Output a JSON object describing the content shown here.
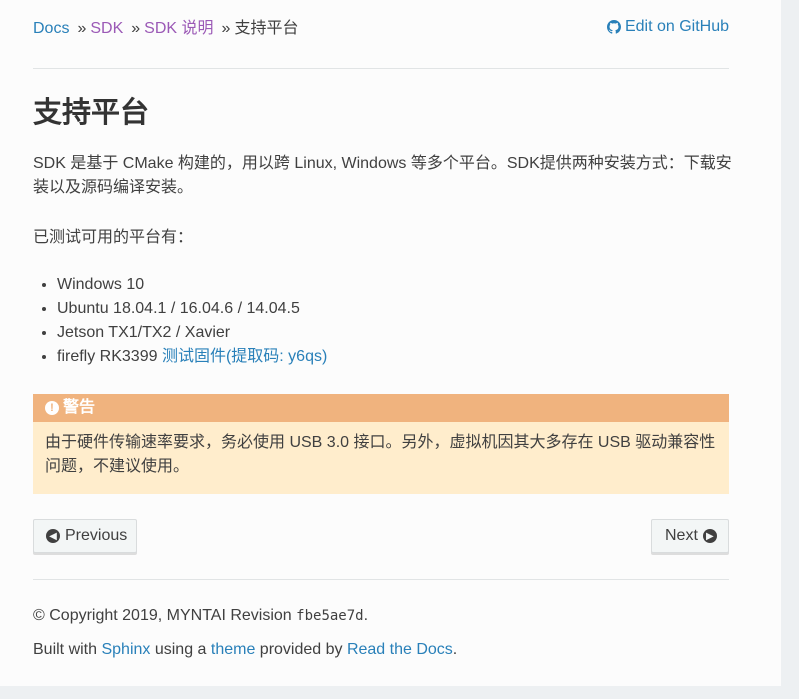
{
  "breadcrumbs": {
    "items": [
      {
        "label": "Docs"
      },
      {
        "label": "SDK"
      },
      {
        "label": "SDK 说明"
      }
    ],
    "separator": "»",
    "current": "支持平台",
    "edit_link": "Edit on GitHub"
  },
  "page": {
    "title": "支持平台",
    "intro": "SDK 是基于 CMake 构建的，用以跨 Linux, Windows 等多个平台。SDK提供两种安装方式：下载安装以及源码编译安装。",
    "tested_label": "已测试可用的平台有：",
    "platforms": [
      "Windows 10",
      "Ubuntu 18.04.1 / 16.04.6 / 14.04.5",
      "Jetson TX1/TX2 / Xavier",
      "firefly RK3399"
    ],
    "firmware_link": "测试固件(提取码: y6qs)"
  },
  "warning": {
    "title": "警告",
    "body": "由于硬件传输速率要求，务必使用 USB 3.0 接口。另外，虚拟机因其大多存在 USB 驱动兼容性问题，不建议使用。"
  },
  "nav": {
    "previous_label": "Previous",
    "next_label": "Next"
  },
  "footer": {
    "copyright": "© Copyright 2019, MYNTAI Revision ",
    "revision": "fbe5ae7d",
    "period": ".",
    "built_with": "Built with ",
    "sphinx": "Sphinx",
    "using_a": " using a ",
    "theme": "theme",
    "provided_by": " provided by ",
    "rtd": "Read the Docs",
    "end": "."
  },
  "colors": {
    "link": "#2980b9",
    "visited": "#9b59b6",
    "warning_title_bg": "#f0b37e",
    "warning_body_bg": "#ffedcc"
  },
  "icons": {
    "github": "github-icon",
    "warning": "exclamation-circle-icon",
    "previous": "arrow-circle-left-icon",
    "next": "arrow-circle-right-icon"
  }
}
